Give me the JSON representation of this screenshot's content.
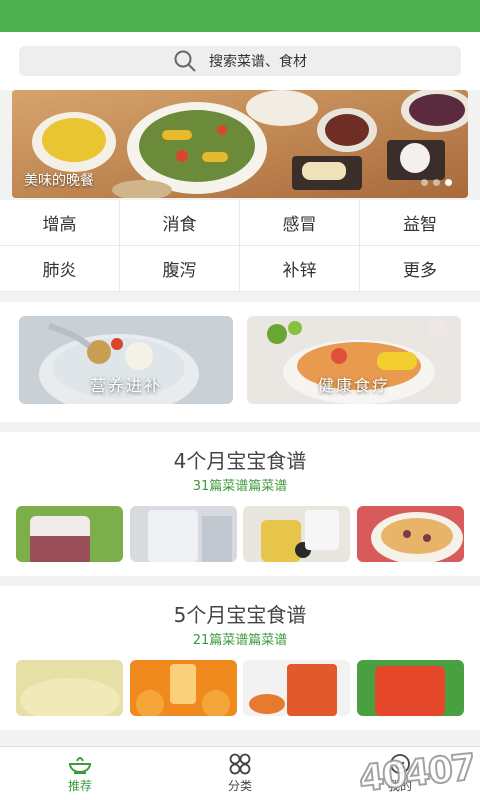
{
  "search": {
    "placeholder": "搜索菜谱、食材"
  },
  "banner": {
    "caption": "美味的晚餐",
    "slide_count": 3,
    "active_slide": 3
  },
  "categories": [
    "增高",
    "消食",
    "感冒",
    "益智",
    "肺炎",
    "腹泻",
    "补锌",
    "更多"
  ],
  "features": [
    {
      "label": "营养进补"
    },
    {
      "label": "健康食疗"
    }
  ],
  "sections": [
    {
      "title": "4个月宝宝食谱",
      "subtitle": "31篇菜谱篇菜谱"
    },
    {
      "title": "5个月宝宝食谱",
      "subtitle": "21篇菜谱篇菜谱"
    }
  ],
  "tabbar": {
    "items": [
      {
        "label": "推荐",
        "icon": "bowl-icon",
        "active": true
      },
      {
        "label": "分类",
        "icon": "grid-icon",
        "active": false
      },
      {
        "label": "我的",
        "icon": "profile-icon",
        "active": false
      }
    ]
  },
  "watermark": "40407",
  "colors": {
    "brand": "#4caf50",
    "accent_text": "#3e9a3e"
  }
}
